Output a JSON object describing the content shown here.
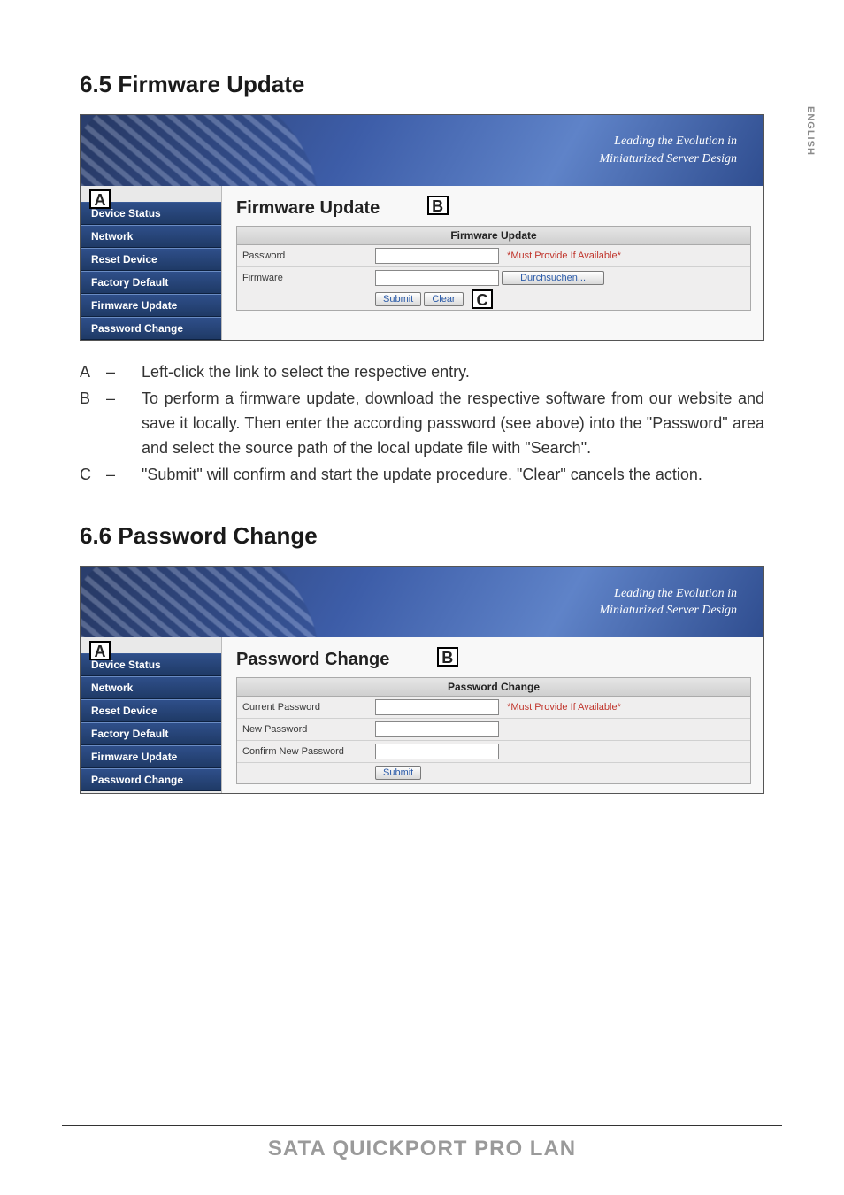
{
  "sidetab": "ENGLISH",
  "banner_tagline_l1": "Leading the Evolution in",
  "banner_tagline_l2": "Miniaturized Server Design",
  "callouts": {
    "A": "A",
    "B": "B",
    "C": "C"
  },
  "sidebar": {
    "items": [
      {
        "label": "Device Status"
      },
      {
        "label": "Network"
      },
      {
        "label": "Reset Device"
      },
      {
        "label": "Factory Default"
      },
      {
        "label": "Firmware Update"
      },
      {
        "label": "Password Change"
      }
    ]
  },
  "section1": {
    "heading": "6.5 Firmware Update",
    "content_title": "Firmware Update",
    "panel_title": "Firmware Update",
    "row_password_label": "Password",
    "row_password_hint": "*Must Provide If Available*",
    "row_firmware_label": "Firmware",
    "browse_btn": "Durchsuchen...",
    "submit_btn": "Submit",
    "clear_btn": "Clear",
    "explain": {
      "A": "Left-click the link to select the respective entry.",
      "B": "To perform a firmware update, download the respective software from our website and save it locally. Then enter the according password (see above) into the \"Password\" area and select the source path of the local update file with \"Search\".",
      "C": "\"Submit\" will confirm and start the update procedure. \"Clear\" cancels the action."
    }
  },
  "section2": {
    "heading": "6.6 Password Change",
    "content_title": "Password Change",
    "panel_title": "Password Change",
    "row_current_label": "Current Password",
    "row_current_hint": "*Must Provide If Available*",
    "row_new_label": "New Password",
    "row_confirm_label": "Confirm New Password",
    "submit_btn": "Submit"
  },
  "footer": "SATA QUICKPORT PRO LAN"
}
